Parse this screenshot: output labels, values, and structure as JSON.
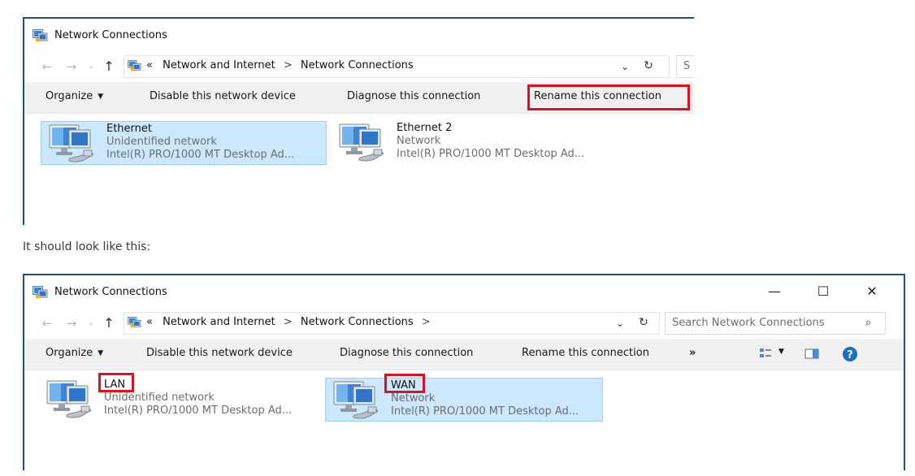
{
  "caption": "It should look like this:",
  "before": {
    "title": "Network Connections",
    "breadcrumb": [
      "«",
      "Network and Internet",
      ">",
      "Network Connections"
    ],
    "search_placeholder": "S",
    "toolbar": {
      "organize": "Organize",
      "disable": "Disable this network device",
      "diagnose": "Diagnose this connection",
      "rename": "Rename this connection"
    },
    "items": [
      {
        "name": "Ethernet",
        "status": "Unidentified network",
        "adapter": "Intel(R) PRO/1000 MT Desktop Ad...",
        "selected": true
      },
      {
        "name": "Ethernet 2",
        "status": "Network",
        "adapter": "Intel(R) PRO/1000 MT Desktop Ad...",
        "selected": false
      }
    ]
  },
  "after": {
    "title": "Network Connections",
    "window_controls": {
      "minimize": "—",
      "maximize": "☐",
      "close": "✕"
    },
    "breadcrumb": [
      "«",
      "Network and Internet",
      ">",
      "Network Connections",
      ">"
    ],
    "search_placeholder": "Search Network Connections",
    "toolbar": {
      "organize": "Organize",
      "disable": "Disable this network device",
      "diagnose": "Diagnose this connection",
      "rename": "Rename this connection",
      "more": "»"
    },
    "items": [
      {
        "name": "LAN",
        "status": "Unidentified network",
        "adapter": "Intel(R) PRO/1000 MT Desktop Ad...",
        "selected": false
      },
      {
        "name": "WAN",
        "status": "Network",
        "adapter": "Intel(R) PRO/1000 MT Desktop Ad...",
        "selected": true
      }
    ]
  },
  "colors": {
    "highlight": "#e0101c",
    "selection": "#cce8ff",
    "window_border": "#1e4f87",
    "help": "#1a6fc9"
  }
}
